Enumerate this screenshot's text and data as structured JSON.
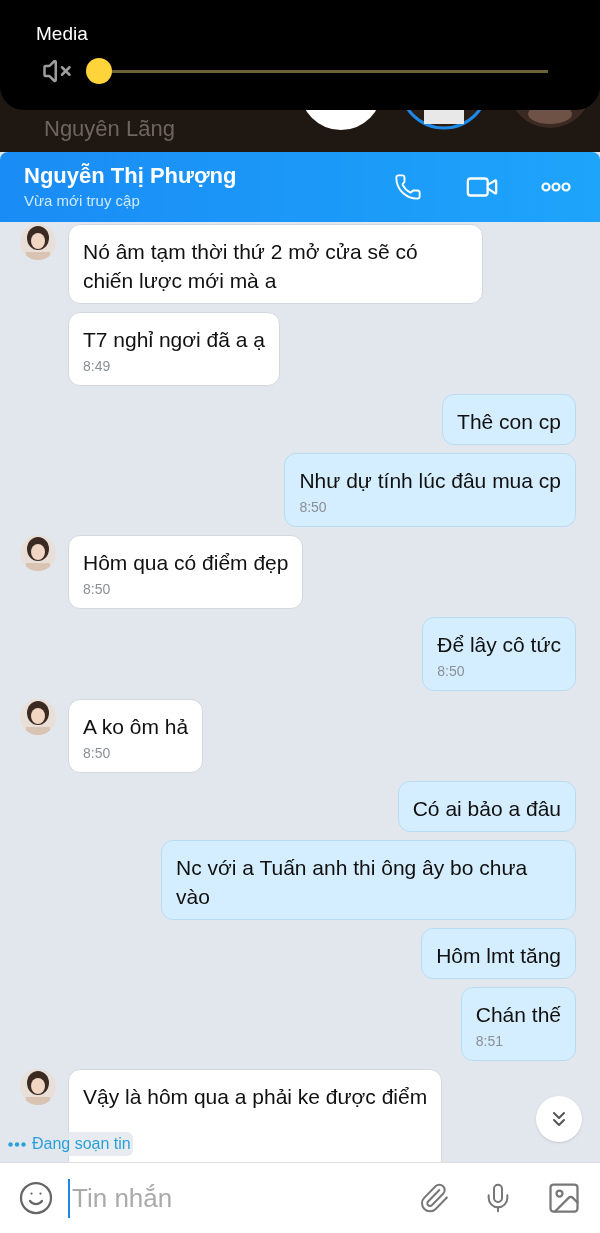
{
  "volume_panel": {
    "title": "Media",
    "muted": true,
    "level": 0.0
  },
  "background": {
    "contact_name": "Nguyên Lãng"
  },
  "header": {
    "name": "Nguyễn Thị Phượng",
    "status": "Vừa mới truy cập"
  },
  "messages": [
    {
      "kind": "incoming",
      "avatar": true,
      "text": "Nó âm tạm thời thứ 2 mở cửa sẽ có chiến lược mới mà a"
    },
    {
      "kind": "incoming",
      "avatar": false,
      "text": "T7 nghỉ ngơi đã a ạ",
      "time": "8:49"
    },
    {
      "kind": "outgoing",
      "text": "Thê con cp"
    },
    {
      "kind": "outgoing",
      "text": "Như dự tính lúc đâu  mua cp",
      "time": "8:50"
    },
    {
      "kind": "incoming",
      "avatar": true,
      "text": "Hôm qua có điểm đẹp",
      "time": "8:50"
    },
    {
      "kind": "outgoing",
      "text": "Để lây cô tức",
      "time": "8:50"
    },
    {
      "kind": "incoming",
      "avatar": true,
      "text": "A ko ôm hả",
      "time": "8:50"
    },
    {
      "kind": "outgoing",
      "text": "Có ai bảo a đâu"
    },
    {
      "kind": "outgoing",
      "text": "Nc với a Tuấn anh thi ông ây bo chưa vào"
    },
    {
      "kind": "outgoing",
      "text": "Hôm lmt tăng"
    },
    {
      "kind": "outgoing",
      "text": "Chán thế",
      "time": "8:51"
    },
    {
      "kind": "incoming",
      "avatar": true,
      "text": "Vậy là hôm qua a phải ke được điểm"
    }
  ],
  "typing_indicator": "Đang soạn tin",
  "composer": {
    "placeholder": "Tin nhắn"
  }
}
